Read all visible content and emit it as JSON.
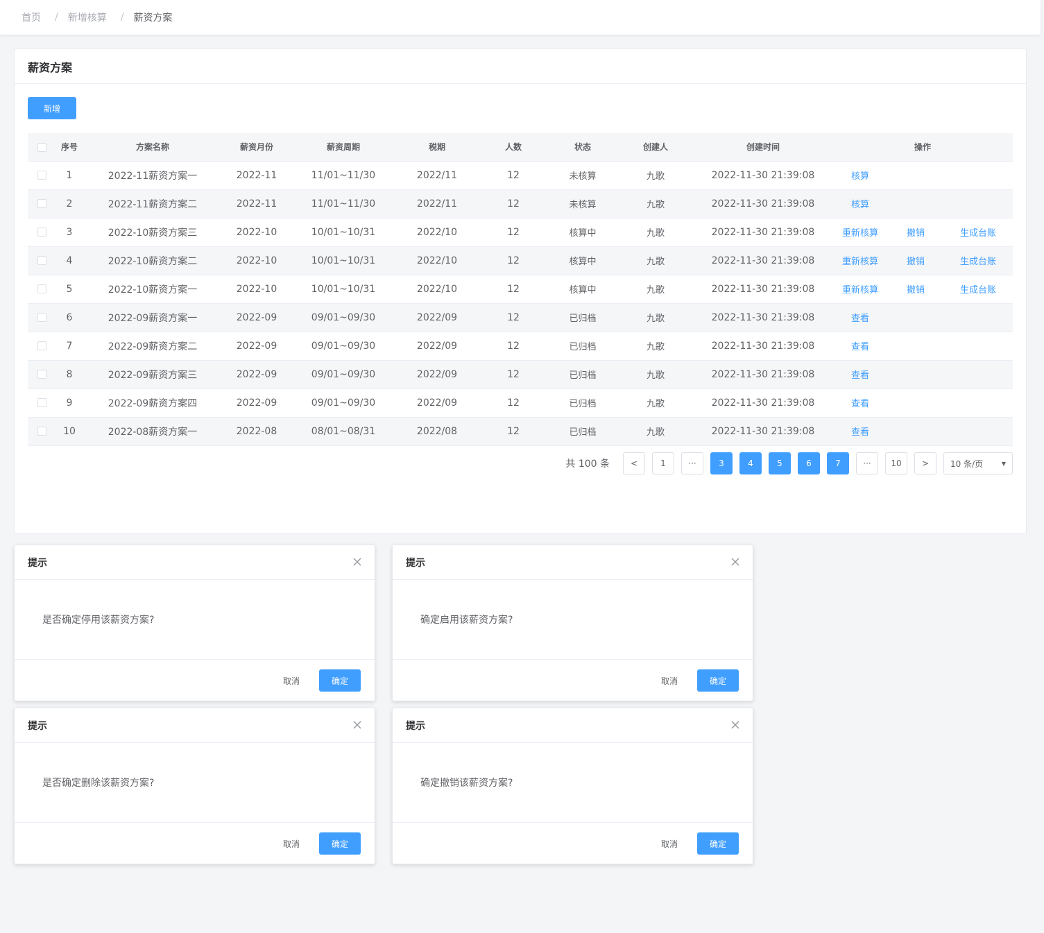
{
  "breadcrumb": [
    "首页",
    "新增核算",
    "薪资方案"
  ],
  "card": {
    "title": "薪资方案",
    "add_label": "新增"
  },
  "table": {
    "headers": [
      "序号",
      "方案名称",
      "薪资月份",
      "薪资周期",
      "税期",
      "人数",
      "状态",
      "创建人",
      "创建时间",
      "操作"
    ],
    "rows": [
      {
        "no": "1",
        "name": "2022-11薪资方案一",
        "month": "2022-11",
        "period": "11/01~11/30",
        "tax": "2022/11",
        "count": "12",
        "status": "未核算",
        "creator": "九歌",
        "time": "2022-11-30 21:39:08",
        "actions": [
          "核算"
        ]
      },
      {
        "no": "2",
        "name": "2022-11薪资方案二",
        "month": "2022-11",
        "period": "11/01~11/30",
        "tax": "2022/11",
        "count": "12",
        "status": "未核算",
        "creator": "九歌",
        "time": "2022-11-30 21:39:08",
        "actions": [
          "核算"
        ]
      },
      {
        "no": "3",
        "name": "2022-10薪资方案三",
        "month": "2022-10",
        "period": "10/01~10/31",
        "tax": "2022/10",
        "count": "12",
        "status": "核算中",
        "creator": "九歌",
        "time": "2022-11-30 21:39:08",
        "actions": [
          "重新核算",
          "撤销",
          "生成台账"
        ]
      },
      {
        "no": "4",
        "name": "2022-10薪资方案二",
        "month": "2022-10",
        "period": "10/01~10/31",
        "tax": "2022/10",
        "count": "12",
        "status": "核算中",
        "creator": "九歌",
        "time": "2022-11-30 21:39:08",
        "actions": [
          "重新核算",
          "撤销",
          "生成台账"
        ]
      },
      {
        "no": "5",
        "name": "2022-10薪资方案一",
        "month": "2022-10",
        "period": "10/01~10/31",
        "tax": "2022/10",
        "count": "12",
        "status": "核算中",
        "creator": "九歌",
        "time": "2022-11-30 21:39:08",
        "actions": [
          "重新核算",
          "撤销",
          "生成台账"
        ]
      },
      {
        "no": "6",
        "name": "2022-09薪资方案一",
        "month": "2022-09",
        "period": "09/01~09/30",
        "tax": "2022/09",
        "count": "12",
        "status": "已归档",
        "creator": "九歌",
        "time": "2022-11-30 21:39:08",
        "actions": [
          "查看"
        ]
      },
      {
        "no": "7",
        "name": "2022-09薪资方案二",
        "month": "2022-09",
        "period": "09/01~09/30",
        "tax": "2022/09",
        "count": "12",
        "status": "已归档",
        "creator": "九歌",
        "time": "2022-11-30 21:39:08",
        "actions": [
          "查看"
        ]
      },
      {
        "no": "8",
        "name": "2022-09薪资方案三",
        "month": "2022-09",
        "period": "09/01~09/30",
        "tax": "2022/09",
        "count": "12",
        "status": "已归档",
        "creator": "九歌",
        "time": "2022-11-30 21:39:08",
        "actions": [
          "查看"
        ]
      },
      {
        "no": "9",
        "name": "2022-09薪资方案四",
        "month": "2022-09",
        "period": "09/01~09/30",
        "tax": "2022/09",
        "count": "12",
        "status": "已归档",
        "creator": "九歌",
        "time": "2022-11-30 21:39:08",
        "actions": [
          "查看"
        ]
      },
      {
        "no": "10",
        "name": "2022-08薪资方案一",
        "month": "2022-08",
        "period": "08/01~08/31",
        "tax": "2022/08",
        "count": "12",
        "status": "已归档",
        "creator": "九歌",
        "time": "2022-11-30 21:39:08",
        "actions": [
          "查看"
        ]
      }
    ]
  },
  "pagination": {
    "total_label": "共 100 条",
    "prev": "<",
    "next": ">",
    "ellipsis": "···",
    "first": "1",
    "pages": [
      "3",
      "4",
      "5",
      "6",
      "7"
    ],
    "last": "10",
    "page_size": "10 条/页"
  },
  "dialogs": [
    {
      "title": "提示",
      "message": "是否确定停用该薪资方案?",
      "cancel": "取消",
      "ok": "确定"
    },
    {
      "title": "提示",
      "message": "确定启用该薪资方案?",
      "cancel": "取消",
      "ok": "确定"
    },
    {
      "title": "提示",
      "message": "是否确定删除该薪资方案?",
      "cancel": "取消",
      "ok": "确定"
    },
    {
      "title": "提示",
      "message": "确定撤销该薪资方案?",
      "cancel": "取消",
      "ok": "确定"
    }
  ],
  "colors": {
    "primary": "#409eff",
    "background": "#f4f5f7",
    "stripe": "#f5f6f8",
    "text": "#606266"
  }
}
